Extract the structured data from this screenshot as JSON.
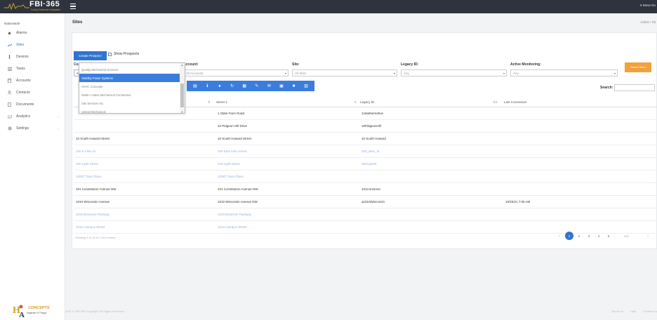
{
  "topbar": {
    "brand": "FBI·365",
    "tagline": "Facility Business Integration",
    "user": "▾ Steve Do"
  },
  "sidebar": {
    "title": "Nationwide",
    "items": [
      {
        "label": "Alarms",
        "icon": "bell-icon"
      },
      {
        "label": "Sites",
        "icon": "chart-icon",
        "active": true
      },
      {
        "label": "Devices",
        "icon": "device-icon"
      },
      {
        "label": "Tasks",
        "icon": "list-icon"
      },
      {
        "label": "Accounts",
        "icon": "building-icon"
      },
      {
        "label": "Contacts",
        "icon": "user-icon"
      },
      {
        "label": "Documents",
        "icon": "document-icon"
      },
      {
        "label": "Analytics",
        "icon": "analytics-icon",
        "expandable": true
      },
      {
        "label": "Settings",
        "icon": "gear-icon",
        "expandable": true
      }
    ],
    "footer_logo": {
      "text": "CONCEPTS",
      "sub": "magician of Things!"
    }
  },
  "page": {
    "title": "Sites",
    "breadcrumb": "Admin  /  Sit"
  },
  "controls": {
    "create_label": "Create Prospect",
    "show_prospects": "Show Prospects",
    "reset_label": "Reset Filters",
    "filters": [
      {
        "label": "Company:",
        "value": "All Companies"
      },
      {
        "label": "Account:",
        "value": "All Accounts"
      },
      {
        "label": "Site:",
        "value": "All Sites"
      },
      {
        "label": "Legacy ID:",
        "value": "Any"
      },
      {
        "label": "Active Monitoring:",
        "value": "Any"
      }
    ],
    "search_label": "Search:"
  },
  "dropdown": {
    "items": [
      "Quality Mechanical Services",
      "Stability Power Systems",
      "HVAC Concepts",
      "Martin L Bass Mechanical Contractors",
      "Site Services Inc",
      "United Mechanical"
    ],
    "selected_index": 1
  },
  "table": {
    "headers": [
      "Street 1",
      "Legacy ID",
      "Last Connection"
    ],
    "rows": [
      {
        "name": "",
        "street": "1 State Farm Road",
        "legacy": "1statefarmdrive",
        "last": "",
        "faded": false
      },
      {
        "name": "",
        "street": "10 Pidgeon Hill Drive",
        "legacy": "10PidgeonHill",
        "last": "",
        "faded": false
      },
      {
        "name": "10 South Howard Street",
        "street": "10 South Howard Street",
        "legacy": "10 South Howard",
        "last": "",
        "faded": false
      },
      {
        "name": "100 E Aliso St",
        "street": "100 East Aliso Street",
        "legacy": "100_aliso_st",
        "last": "",
        "faded": true
      },
      {
        "name": "100 Light Street",
        "street": "100 Light Street",
        "legacy": "100LightSt",
        "last": "",
        "faded": true
      },
      {
        "name": "10087 Town Place",
        "street": "10087 Town Place",
        "legacy": "",
        "last": "",
        "faded": true
      },
      {
        "name": "101 Constitution Avenue NW",
        "street": "101 Constitution Avenue NW",
        "legacy": "101ConstAve",
        "last": "",
        "faded": false
      },
      {
        "name": "1010 Wisconsin Avenue",
        "street": "1010 Wisconsin Avenue NW",
        "legacy": "a1010Wisconsin",
        "last": "10/25/21 7:00 AM",
        "faded": false
      },
      {
        "name": "1010 Business Parkway",
        "street": "1010 Business Parkway",
        "legacy": "",
        "last": "",
        "faded": true
      },
      {
        "name": "1010 Campus Street",
        "street": "1010 Campus Street",
        "legacy": "",
        "last": "",
        "faded": true
      }
    ]
  },
  "pagination": {
    "info": "Showing 1 to 10 of 2,219 entries",
    "prev": "‹",
    "pages": [
      "1",
      "2",
      "3",
      "4",
      "5"
    ],
    "active_page": "1",
    "goto": "222",
    "next": "›",
    "last": "»"
  },
  "footer": {
    "copyright": "2021 © FBI·365 Copyright. All Rights Reserved.",
    "links": [
      "About Us",
      "Help",
      "Contact Us"
    ]
  }
}
